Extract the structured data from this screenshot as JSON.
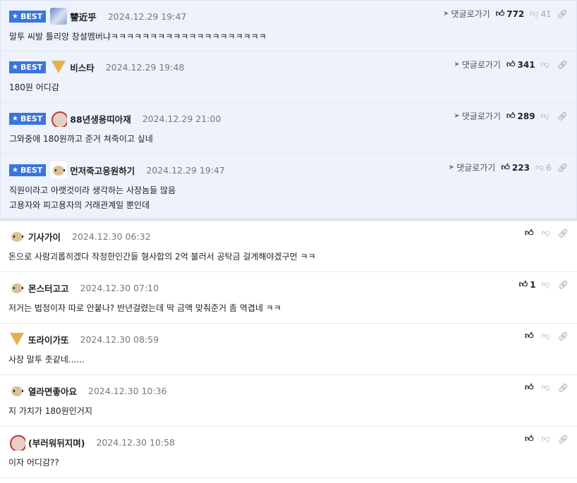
{
  "labels": {
    "best": "BEST",
    "reply": "댓글로가기"
  },
  "colors": {
    "best_bg": "#eef2fd",
    "badge": "#3a74e0"
  },
  "comments": [
    {
      "best": true,
      "avatar": "blue-avatar-icon",
      "nick": "讐近乎",
      "date": "2024.12.29 19:47",
      "up": "772",
      "down": "41",
      "lines": [
        "말투 씨발 틀리앙 창설멤버냐ㅋㅋㅋㅋㅋㅋㅋㅋㅋㅋㅋㅋㅋㅋㅋㅋㅋㅋㅋㅋ"
      ]
    },
    {
      "best": true,
      "avatar": "fox-avatar-icon",
      "nick": "비스타",
      "date": "2024.12.29 19:48",
      "up": "341",
      "down": "",
      "lines": [
        "180원 어디감"
      ]
    },
    {
      "best": true,
      "avatar": "red-dog-avatar-icon",
      "nick": "88년생용띠아재",
      "date": "2024.12.29 21:00",
      "up": "289",
      "down": "",
      "lines": [
        "그와중에 180원까고 준거 쳐죽이고 싶네"
      ]
    },
    {
      "best": true,
      "avatar": "dog-avatar-icon",
      "nick": "먼저죽고응원하기",
      "date": "2024.12.29 19:47",
      "up": "223",
      "down": "6",
      "lines": [
        "직원이라고 아랫것이라 생각하는 사장놈들 많음",
        "고용자와 피고용자의 거래관계일 뿐인데"
      ]
    },
    {
      "best": false,
      "avatar": "dog-avatar-icon",
      "nick": "기사가이",
      "date": "2024.12.30 06:32",
      "up": "",
      "down": "",
      "lines": [
        "돈으로 사람괴롭히겠다 작정한인간들 형사합의 2억 불러서 공탁금 걸게해야겠구먼 ㅋㅋ"
      ]
    },
    {
      "best": false,
      "avatar": "dog-avatar-icon",
      "nick": "몬스터고고",
      "date": "2024.12.30 07:10",
      "up": "1",
      "down": "",
      "lines": [
        "저거는 법정이자 따로 안붙나? 반년걸렸는데 딱 금액 맞춰준거 좀 역겹네 ㅋㅋ"
      ]
    },
    {
      "best": false,
      "avatar": "fox-avatar-icon",
      "nick": "또라이가또",
      "date": "2024.12.30 08:59",
      "up": "",
      "down": "",
      "lines": [
        "사장 말투 좃같네......"
      ]
    },
    {
      "best": false,
      "avatar": "dog-avatar-icon",
      "nick": "열라면좋아요",
      "date": "2024.12.30 10:36",
      "up": "",
      "down": "",
      "lines": [
        "지 가치가 180원인거지"
      ]
    },
    {
      "best": false,
      "avatar": "red-dog-avatar-icon",
      "nick": "(부러워뒤지며)",
      "date": "2024.12.30 10:58",
      "up": "",
      "down": "",
      "lines": [
        "이자 어디감??"
      ]
    }
  ]
}
